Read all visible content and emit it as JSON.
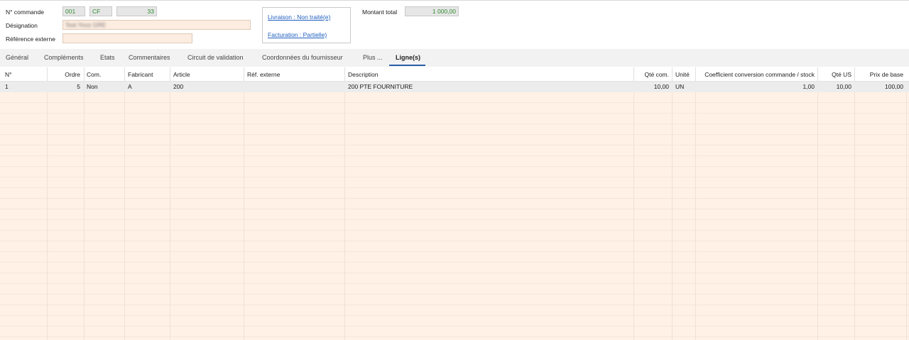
{
  "header": {
    "order_number_label": "N° commande",
    "order_number_part1": "001",
    "order_number_part2": "CF",
    "order_number_part3": "33",
    "designation_label": "Désignation",
    "designation_value": "Test Yooz GRE",
    "external_ref_label": "Référence externe",
    "external_ref_value": "",
    "total_amount_label": "Montant total",
    "total_amount_value": "1 000,00"
  },
  "status": {
    "delivery_link": "Livraison : Non traité(e)",
    "billing_link": "Facturation : Partielle)"
  },
  "tabs": [
    {
      "label": "Général"
    },
    {
      "label": "Compléments"
    },
    {
      "label": "Etats"
    },
    {
      "label": "Commentaires"
    },
    {
      "label": "Circuit de validation"
    },
    {
      "label": "Coordonnées du fournisseur"
    },
    {
      "label": "Plus ..."
    },
    {
      "label": "Ligne(s)"
    }
  ],
  "active_tab": "Ligne(s)",
  "table": {
    "columns": [
      "N°",
      "Ordre",
      "Com.",
      "Fabricant",
      "Article",
      "Réf. externe",
      "Description",
      "Qté com.",
      "Unité",
      "Coefficient conversion commande / stock",
      "Qté US",
      "Prix de base"
    ],
    "rows": [
      [
        "1",
        "5",
        "Non",
        "A",
        "200",
        "",
        "200 PTE FOURNITURE",
        "10,00",
        "UN",
        "1,00",
        "10,00",
        "100,00"
      ]
    ]
  },
  "colors": {
    "accent": "#2a5fa8",
    "link": "#1f5fbf",
    "readonly_text": "#2e8b2e",
    "grid_background": "#fff1e6",
    "selected_row": "#ececec"
  }
}
